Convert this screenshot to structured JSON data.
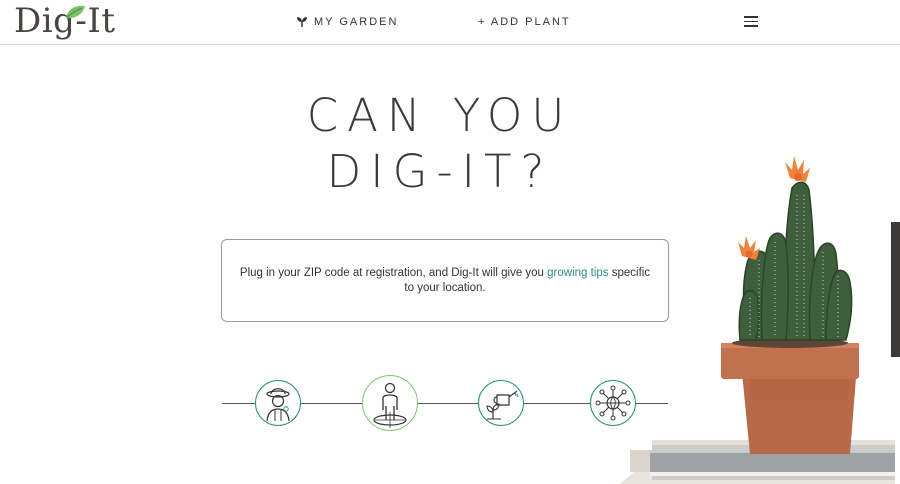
{
  "header": {
    "logo_text": "Dig-It",
    "nav": [
      {
        "label": "MY GARDEN",
        "icon": "sprout-icon"
      },
      {
        "label": "+ ADD PLANT",
        "icon": "plus-icon"
      }
    ],
    "menu_icon": "hamburger-menu-icon"
  },
  "hero": {
    "title_line1": "CAN YOU",
    "title_line2": "DIG-IT?"
  },
  "info": {
    "text_before": "Plug in your ZIP code at registration, and Dig-It will give you ",
    "link_text": "growing tips",
    "text_after": " specific to your location."
  },
  "steps": [
    {
      "icon": "gardener-icon",
      "active": false
    },
    {
      "icon": "person-location-icon",
      "active": true
    },
    {
      "icon": "watering-can-icon",
      "active": false
    },
    {
      "icon": "network-globe-icon",
      "active": false
    }
  ],
  "colors": {
    "accent": "#2d8a86",
    "active_step": "#7cc26a",
    "logo_leaf": "#7cc26a",
    "pot": "#b86a48"
  }
}
